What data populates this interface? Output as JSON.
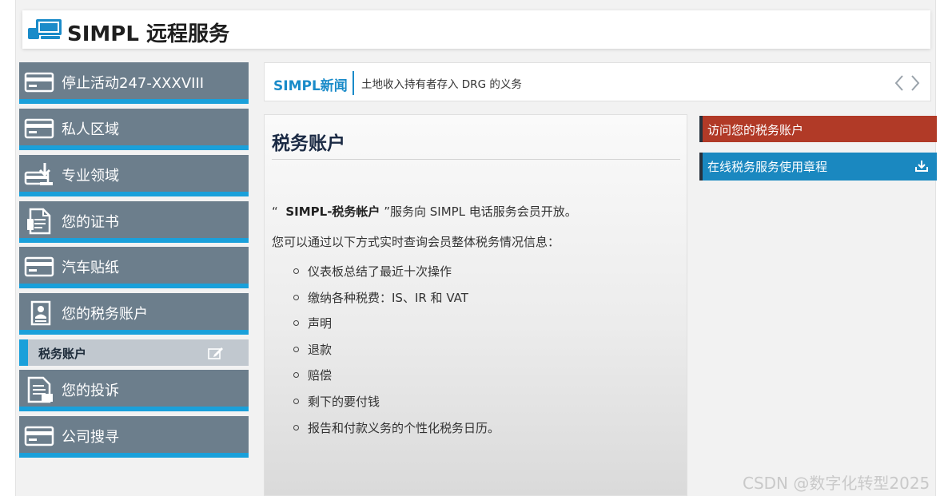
{
  "app": {
    "title": "SIMPL 远程服务"
  },
  "sidebar": {
    "items": [
      {
        "label": "停止活动247-XXXVIII",
        "icon": "card-icon"
      },
      {
        "label": "私人区域",
        "icon": "card-icon"
      },
      {
        "label": "专业领域",
        "icon": "download-tray-icon"
      },
      {
        "label": "您的证书",
        "icon": "certificate-document-icon"
      },
      {
        "label": "汽车贴纸",
        "icon": "card-icon"
      },
      {
        "label": "您的税务账户",
        "icon": "id-card-icon"
      },
      {
        "label": "您的投诉",
        "icon": "complaint-document-icon"
      },
      {
        "label": "公司搜寻",
        "icon": "card-icon"
      }
    ],
    "subitem": {
      "label": "税务账户",
      "icon": "edit-icon"
    }
  },
  "news": {
    "title": "SIMPL新闻",
    "text": "土地收入持有者存入 DRG 的义务"
  },
  "main": {
    "title": "税务账户",
    "intro_quote_open": "“",
    "intro_bold": "SIMPL-税务帐户",
    "intro_rest": "”服务向 SIMPL 电话服务会员开放。",
    "lead": "您可以通过以下方式实时查询会员整体税务情况信息：",
    "features": [
      "仪表板总结了最近十次操作",
      "缴纳各种税费：IS、IR 和 VAT",
      "声明",
      "退款",
      "赔偿",
      "剩下的要付钱",
      "报告和付款义务的个性化税务日历。"
    ]
  },
  "actions": {
    "access_label": "访问您的税务账户",
    "charter_label": "在线税务服务使用章程"
  },
  "watermark": "CSDN @数字化转型2025",
  "colors": {
    "sidebar_bg": "#6c7e8c",
    "accent_blue": "#1aa0da",
    "action_red": "#b13a27",
    "action_blue": "#1a88c0",
    "title_navy": "#1b2a44"
  }
}
